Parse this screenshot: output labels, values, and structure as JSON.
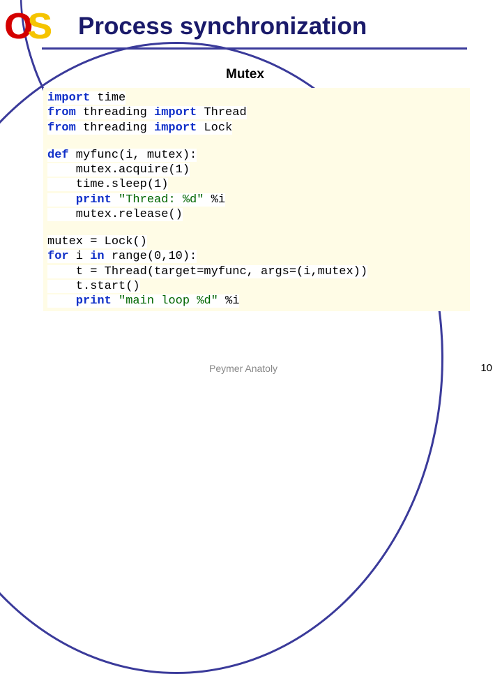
{
  "header": {
    "logo_o": "O",
    "logo_s": "S",
    "title": "Process synchronization",
    "subtitle": "Mutex"
  },
  "code": {
    "l1_kw1": "import",
    "l1_t": " time",
    "l2_kw1": "from",
    "l2_t1": " threading ",
    "l2_kw2": "import",
    "l2_t2": " Thread",
    "l3_kw1": "from",
    "l3_t1": " threading ",
    "l3_kw2": "import",
    "l3_t2": " Lock",
    "l4_kw": "def",
    "l4_t": " myfunc(i, mutex):",
    "l5": "    mutex.acquire(1)",
    "l6": "    time.sleep(1)",
    "l7_kw": "    print ",
    "l7_s": "\"Thread: %d\"",
    "l7_t": " %i",
    "l8": "    mutex.release()",
    "l9": "mutex = Lock()",
    "l10_kw1": "for",
    "l10_t1": " i ",
    "l10_kw2": "in",
    "l10_t2": " range(0,10):",
    "l11": "    t = Thread(target=myfunc, args=(i,mutex))",
    "l12": "    t.start()",
    "l13_kw": "    print ",
    "l13_s": "\"main loop %d\"",
    "l13_t": " %i"
  },
  "footer": {
    "author": "Peymer Anatoly",
    "page": "10"
  }
}
